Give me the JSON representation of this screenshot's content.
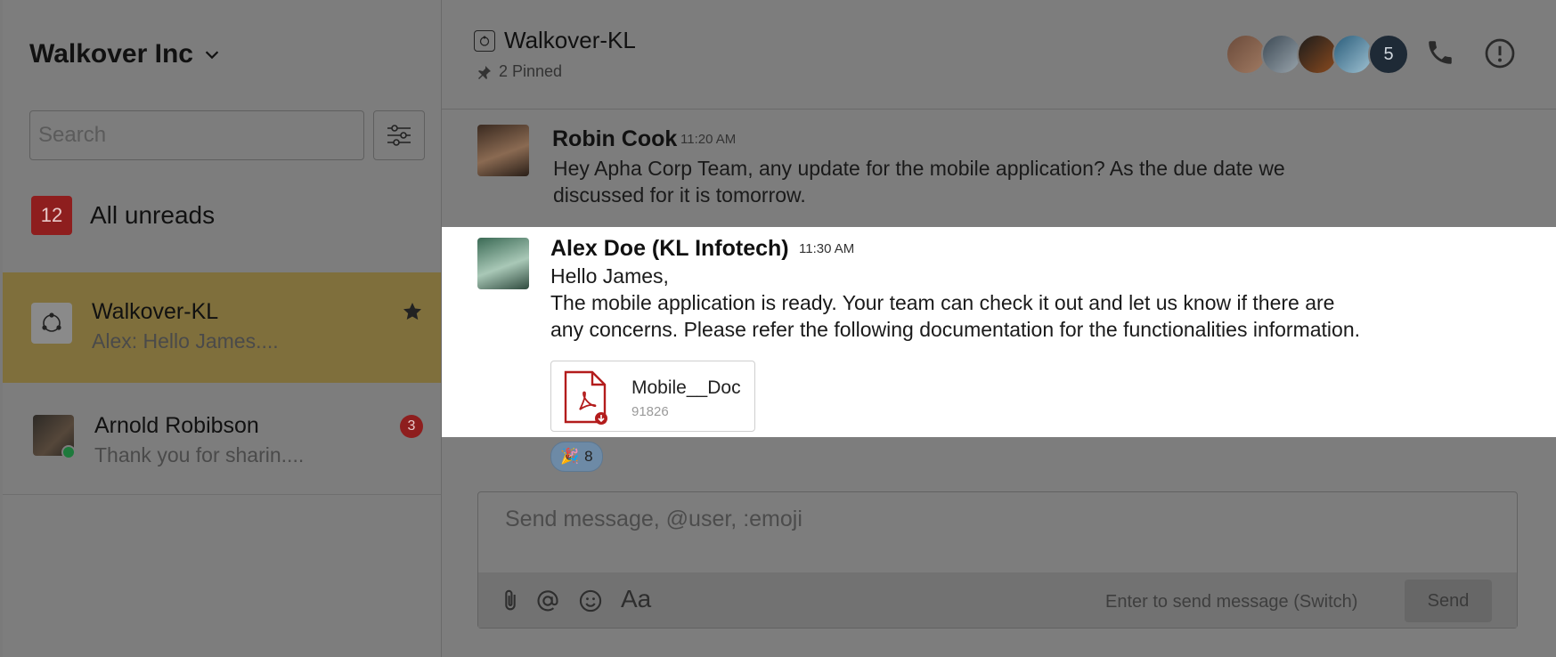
{
  "sidebar": {
    "workspace": "Walkover Inc",
    "search_placeholder": "Search",
    "unreads": {
      "count": "12",
      "label": "All unreads"
    },
    "channels": [
      {
        "name": "Walkover-KL",
        "preview": "Alex: Hello James...."
      },
      {
        "name": "Arnold Robibson",
        "preview": "Thank you for sharin....",
        "badge": "3"
      }
    ]
  },
  "header": {
    "title": "Walkover-KL",
    "pinned": "2 Pinned",
    "members_more": "5"
  },
  "messages": [
    {
      "author": "Robin Cook",
      "time": "11:20 AM",
      "lines": [
        "Hey Apha Corp Team, any update for the mobile application? As the due date we",
        "discussed for it is tomorrow."
      ]
    },
    {
      "author": "Alex Doe (KL Infotech)",
      "time": "11:30 AM",
      "lines": [
        "Hello James,",
        "The mobile application is ready. Your team can check it out and let us know if there are",
        "any concerns. Please refer the following documentation for the functionalities information."
      ],
      "attachment": {
        "name": "Mobile__Doc",
        "size": "91826"
      },
      "reaction": {
        "emoji": "🎉",
        "count": "8"
      }
    }
  ],
  "composer": {
    "placeholder": "Send message, @user, :emoji",
    "hint": "Enter to send message (Switch)",
    "send_label": "Send",
    "format_label": "Aa"
  },
  "colors": {
    "highlight": "#7f6f3c",
    "badge": "#8e1e1e",
    "pdf_red": "#b31c1c"
  }
}
